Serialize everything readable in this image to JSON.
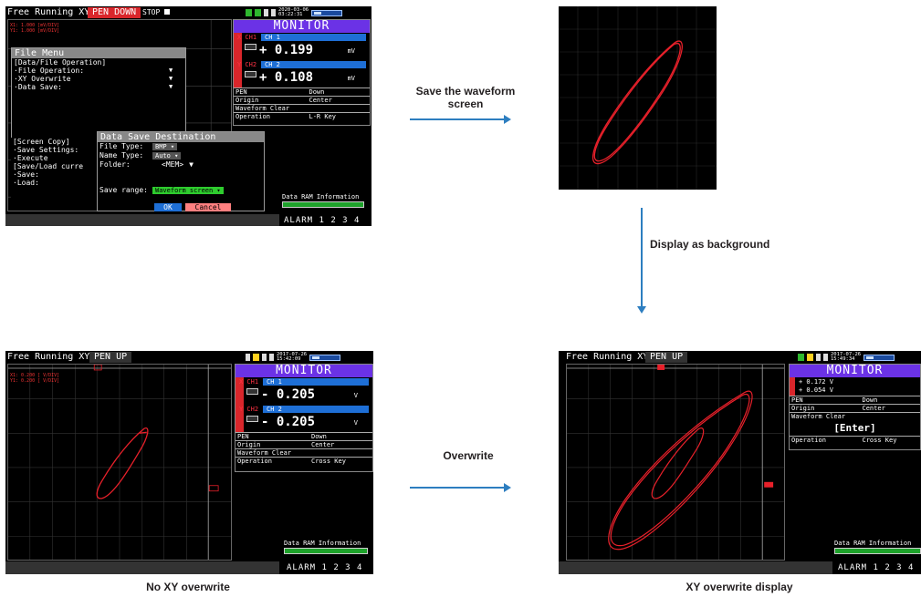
{
  "colors": {
    "accent_blue": "#2d7ec0",
    "trace_red": "#e8202a",
    "monitor_purple": "#6b32e6",
    "pen_down_red": "#d9262b"
  },
  "flow": {
    "save_label": "Save the waveform screen",
    "display_bg_label": "Display as background",
    "overwrite_label": "Overwrite"
  },
  "captions": {
    "no_overwrite": "No XY overwrite",
    "overwrite_display": "XY overwrite display"
  },
  "screen1": {
    "mode": "Free Running XY",
    "pen": "PEN DOWN",
    "stop": "STOP",
    "date": "2020-03-06",
    "time": "03:22:31",
    "scale_x": "X1: 1.000 [mV/DIV]",
    "scale_y": "Y1: 1.000 [mV/DIV]",
    "file_menu": {
      "title": "File Menu",
      "section": "[Data/File Operation]",
      "items": [
        "·File Operation:",
        "·XY Overwrite",
        "·Data Save:"
      ],
      "screen_copy": "[Screen Copy]",
      "save_settings": "·Save Settings:",
      "execute": "·Execute",
      "save_load": "[Save/Load curre",
      "save": "·Save:",
      "load": "·Load:"
    },
    "dialog": {
      "title": "Data Save Destination",
      "file_type_label": "File Type:",
      "file_type_value": "BMP ▾",
      "name_type_label": "Name Type:",
      "name_type_value": "Auto ▾",
      "folder_label": "Folder:",
      "folder_value": "<MEM>",
      "save_range_label": "Save range:",
      "save_range_value": "Waveform screen ▾",
      "ok": "OK",
      "cancel": "Cancel"
    },
    "monitor": {
      "title": "MONITOR",
      "ch1_name": "X CH1",
      "ch1_tag": "CH 1",
      "ch1_value": "+ 0.199",
      "ch1_unit": "mV",
      "ch2_name": "Y CH2",
      "ch2_tag": "CH 2",
      "ch2_value": "+ 0.108",
      "ch2_unit": "mV",
      "rows": [
        {
          "k": "PEN",
          "v": "Down"
        },
        {
          "k": "Origin",
          "v": "Center"
        },
        {
          "k": "Waveform Clear",
          "v": ""
        },
        {
          "k": "Operation",
          "v": "L-R Key"
        }
      ]
    },
    "ram_label": "Data RAM Information",
    "ram_value": "1",
    "alarm": "ALARM 1 2 3 4"
  },
  "screen3": {
    "mode": "Free Running XY",
    "pen": "PEN UP",
    "date": "2017-07-26",
    "time": "15:42:09",
    "scale_x": "X1: 0.200 [ V/DIV]",
    "scale_y": "Y1: 0.200 [ V/DIV]",
    "monitor": {
      "title": "MONITOR",
      "ch1_name": "X CH1",
      "ch1_tag": "CH 1",
      "ch1_value": "- 0.205",
      "ch1_unit": "V",
      "ch2_name": "Y CH2",
      "ch2_tag": "CH 2",
      "ch2_value": "- 0.205",
      "ch2_unit": "V",
      "rows": [
        {
          "k": "PEN",
          "v": "Down"
        },
        {
          "k": "Origin",
          "v": "Center"
        },
        {
          "k": "Waveform Clear",
          "v": ""
        },
        {
          "k": "Operation",
          "v": "Cross Key"
        }
      ]
    },
    "ram_label": "Data RAM Information",
    "ram_value": "1",
    "alarm": "ALARM 1 2 3 4"
  },
  "screen4": {
    "mode": "Free Running XY",
    "pen": "PEN UP",
    "date": "2017-07-26",
    "time": "15:49:34",
    "monitor": {
      "title": "MONITOR",
      "x_line": "+ 0.172 V",
      "y_line": "+ 0.054 V",
      "rows": [
        {
          "k": "PEN",
          "v": "Down"
        },
        {
          "k": "Origin",
          "v": "Center"
        }
      ],
      "waveform_clear": "Waveform Clear",
      "enter": "[Enter]",
      "operation_k": "Operation",
      "operation_v": "Cross Key"
    },
    "ram_label": "Data RAM Information",
    "ram_value": "1",
    "alarm": "ALARM 1 2 3 4"
  }
}
